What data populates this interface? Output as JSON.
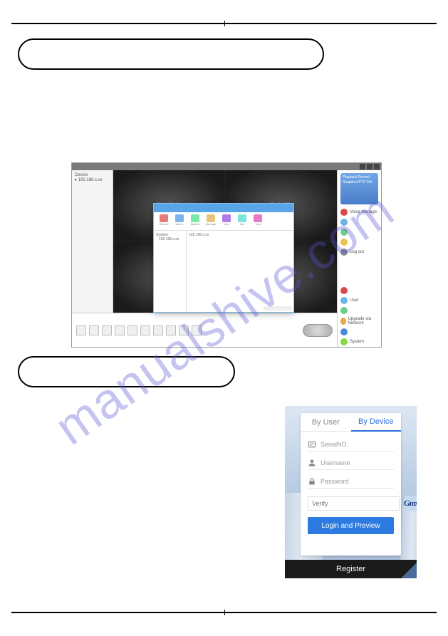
{
  "page": {
    "watermark": "manualshive.com"
  },
  "app": {
    "sidebar_root": "Device",
    "sidebar_node": "192.168.x.xx",
    "quad_left": "H.26",
    "quad_right": "DVR",
    "ptz_lines": "Playback\nRecord\nSnapshot\nPTZ Ctrl",
    "right_items": [
      {
        "label": "Voice Manage",
        "color": "#d94a4a"
      },
      {
        "label": "",
        "color": "#6bb4e8"
      },
      {
        "label": "",
        "color": "#6bd08a"
      },
      {
        "label": "",
        "color": "#e8c24a"
      },
      {
        "label": "Log out",
        "color": "#888"
      }
    ],
    "status_items": [
      {
        "label": "",
        "color": "#d94a4a"
      },
      {
        "label": "User",
        "color": "#6bb4e8"
      },
      {
        "label": "",
        "color": "#6bd08a"
      },
      {
        "label": "Upgrade via Network",
        "color": "#e8a84a"
      },
      {
        "label": "",
        "color": "#4a8ad8"
      },
      {
        "label": "System",
        "color": "#8ad84a"
      }
    ]
  },
  "dialog": {
    "tools": [
      {
        "label": "Record",
        "color": "#e87a7a"
      },
      {
        "label": "Alarm",
        "color": "#7ab4e8"
      },
      {
        "label": "System",
        "color": "#7ae8a4"
      },
      {
        "label": "Manage",
        "color": "#e8c47a"
      },
      {
        "label": "Info",
        "color": "#b47ae8"
      },
      {
        "label": "Net",
        "color": "#7ae8e0"
      },
      {
        "label": "Tool",
        "color": "#e87ac4"
      }
    ],
    "tree_root": "System",
    "tree_item": "192.168.x.xx",
    "list_item": "192.168.x.xx"
  },
  "login": {
    "tab_user": "By User",
    "tab_device": "By Device",
    "serial_placeholder": "SerialNO.",
    "username_placeholder": "Username",
    "password_placeholder": "Password",
    "verify_placeholder": "Verify",
    "captcha_text": "Gmxvl",
    "login_button": "Login and Preview",
    "register_button": "Register"
  }
}
